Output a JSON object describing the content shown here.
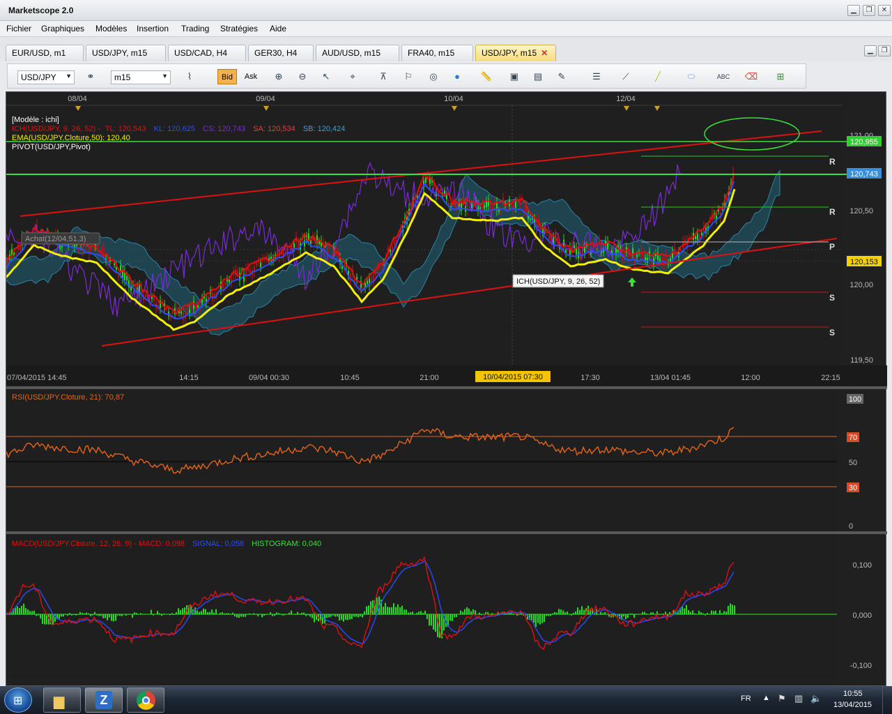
{
  "app": {
    "title": "Marketscope 2.0"
  },
  "menu": [
    "Fichier",
    "Graphiques",
    "Modèles",
    "Insertion",
    "Trading",
    "Stratégies",
    "Aide"
  ],
  "tabs": [
    {
      "label": "EUR/USD, m1",
      "active": false
    },
    {
      "label": "USD/JPY, m15",
      "active": false
    },
    {
      "label": "USD/CAD, H4",
      "active": false
    },
    {
      "label": "GER30, H4",
      "active": false
    },
    {
      "label": "AUD/USD, m15",
      "active": false
    },
    {
      "label": "FRA40, m15",
      "active": false
    },
    {
      "label": "USD/JPY, m15",
      "active": true,
      "close": "✕"
    }
  ],
  "toolbar": {
    "symbol": "USD/JPY",
    "timeframe": "m15",
    "bid_label": "Bid",
    "ask_label": "Ask"
  },
  "chart": {
    "date_markers": [
      "08/04",
      "09/04",
      "10/04",
      "12/04"
    ],
    "x_ticks": [
      "07/04/2015 14:45",
      "14:15",
      "09/04 00:30",
      "10:45",
      "21:00",
      "10/04/2015 07:30",
      "17:30",
      "13/04 01:45",
      "12:00",
      "22:15"
    ],
    "y_ticks": [
      "121,00",
      "120,50",
      "120,00",
      "119,50"
    ],
    "price_tags": {
      "green": "120,955",
      "blue": "120,743",
      "yellow": "120,153"
    },
    "pivot_labels": [
      "R",
      "R",
      "P",
      "S",
      "S"
    ],
    "legend": {
      "model": "[Modèle : ichi]",
      "ich_prefix": "ICH(USD/JPY, 9, 26, 52) -",
      "tl": "TL: 120,543",
      "kl": "KL: 120,625",
      "cs": "CS: 120,743",
      "sa": "SA: 120,534",
      "sb": "SB: 120,424",
      "ema": "EMA(USD/JPY.Cloture,50): 120,40",
      "pivot": "PIVOT(USD/JPY,Pivot)"
    },
    "order_label": "Achat(12/04,51,3)",
    "tooltip": "ICH(USD/JPY, 9, 26, 52)",
    "colors": {
      "bg": "#202020",
      "red": "#e01010",
      "green": "#22dd22",
      "yellow": "#f5f000",
      "blue": "#2a4cff",
      "purple": "#7a2cd6",
      "cyan": "#1e6e8a",
      "orange": "#e5641a"
    }
  },
  "rsi": {
    "legend": "RSI(USD/JPY.Cloture, 21): 70,87",
    "levels": [
      "100",
      "70",
      "50",
      "30",
      "0"
    ]
  },
  "macd": {
    "legend_a": "MACD(USD/JPY.Cloture, 12, 26, 9) -  MACD: 0,098",
    "legend_b": "SIGNAL: 0,058",
    "legend_c": "HISTOGRAM: 0,040",
    "levels": [
      "0,100",
      "0,000",
      "-0,100"
    ]
  },
  "taskbar": {
    "lang": "FR",
    "time": "10:55",
    "date": "13/04/2015"
  }
}
